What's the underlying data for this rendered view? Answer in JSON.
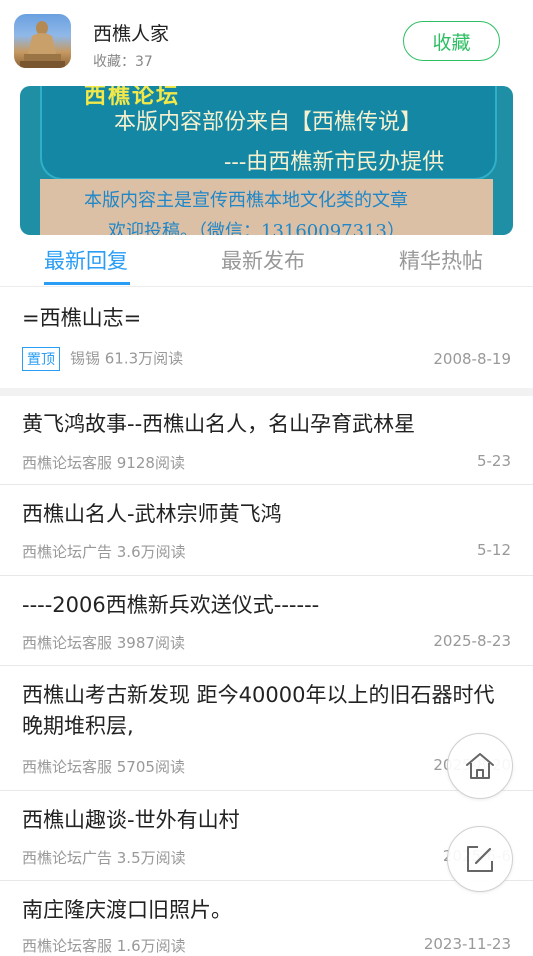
{
  "forum": {
    "name": "西樵人家",
    "favorite_count": "收藏：37",
    "favorite_label": "收藏"
  },
  "banner": {
    "cut_text": "西樵论坛",
    "line1": "本版内容部份来自【西樵传说】",
    "line2": "---由西樵新市民办提供",
    "line3": "本版内容主是宣传西樵本地文化类的文章",
    "line4": "欢迎投稿。（微信：13160097313）"
  },
  "tabs": [
    {
      "label": "最新回复",
      "active": true
    },
    {
      "label": "最新发布",
      "active": false
    },
    {
      "label": "精华热帖",
      "active": false
    }
  ],
  "pinned_post": {
    "title": "=西樵山志=",
    "badge": "置顶",
    "meta": "锡锡 61.3万阅读",
    "date": "2008-8-19"
  },
  "posts": [
    {
      "title": "黄飞鸿故事--西樵山名人，名山孕育武林星",
      "meta": "西樵论坛客服 9128阅读",
      "date": "5-23"
    },
    {
      "title": "西樵山名人-武林宗师黄飞鸿",
      "meta": "西樵论坛广告 3.6万阅读",
      "date": "5-12"
    },
    {
      "title": "----2006西樵新兵欢送仪式------",
      "meta": "西樵论坛客服 3987阅读",
      "date": "2025-8-23"
    },
    {
      "title": "西樵山考古新发现 距今40000年以上的旧石器时代晚期堆积层,",
      "meta": "西樵论坛客服 5705阅读",
      "date": "2025-8-20"
    },
    {
      "title": "西樵山趣谈-世外有山村",
      "meta": "西樵论坛广告 3.5万阅读",
      "date": "2025-6-6"
    },
    {
      "title": "南庄隆庆渡口旧照片。",
      "meta": "西樵论坛客服 1.6万阅读",
      "date": "2023-11-23"
    }
  ],
  "fabs": {
    "home_icon": "home-icon",
    "edit_icon": "edit-icon"
  },
  "colors": {
    "accent_blue": "#2a9df4",
    "favorite_green": "#2fbf63"
  }
}
